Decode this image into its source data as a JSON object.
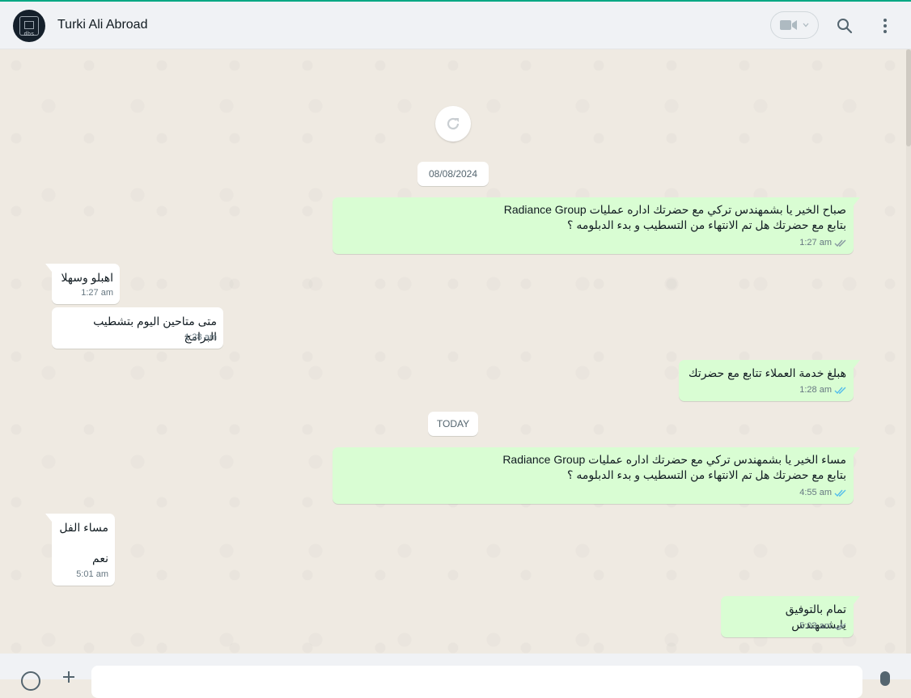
{
  "header": {
    "contact_name": "Turki Ali Abroad",
    "avatar_label": "dbs",
    "icons": [
      "video-call-icon",
      "search-icon",
      "menu-icon"
    ]
  },
  "colors": {
    "accent": "#00a884",
    "outgoing_bubble": "#d9fdd3",
    "incoming_bubble": "#ffffff",
    "read_ticks": "#53bdeb",
    "delivered_ticks": "#8696a0"
  },
  "chat": {
    "date_separators": [
      "08/08/2024",
      "TODAY"
    ],
    "messages": [
      {
        "direction": "out",
        "text": "صباح الخير يا بشمهندس تركي مع  حضرتك اداره عمليات Radiance Group\nبتابع مع حضرتك هل تم الانتهاء من التسطيب و بدء الدبلومه ؟",
        "time": "1:27 am",
        "status": "delivered"
      },
      {
        "direction": "in",
        "text": "اهبلو وسهلا",
        "time": "1:27 am"
      },
      {
        "direction": "in",
        "text": "متى متاحين اليوم بتشطيب البرامج",
        "time": "1:28 am"
      },
      {
        "direction": "out",
        "text": "هبلغ خدمة العملاء تتابع مع حضرتك",
        "time": "1:28 am",
        "status": "read"
      },
      {
        "direction": "out",
        "text": "مساء الخير يا بشمهندس تركي مع  حضرتك اداره عمليات Radiance Group\nبتابع مع حضرتك هل تم الانتهاء من التسطيب و بدء الدبلومه ؟",
        "time": "4:55 am",
        "status": "read"
      },
      {
        "direction": "in",
        "text": "مساء الفل\n\nنعم",
        "time": "5:01 am"
      },
      {
        "direction": "out",
        "text": "تمام بالتوفيق يابشمهندس",
        "time": "5:03 am",
        "status": "delivered"
      }
    ]
  }
}
